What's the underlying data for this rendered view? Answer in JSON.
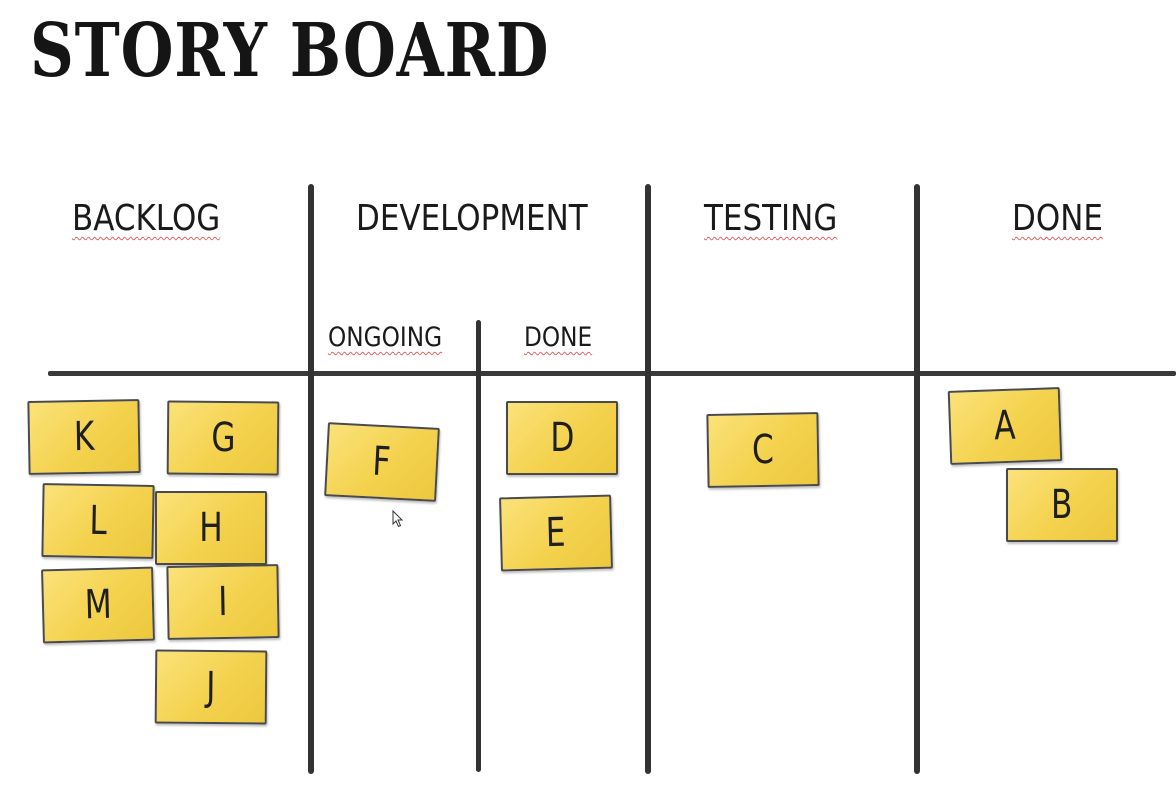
{
  "title": "STORY BOARD",
  "columns": {
    "backlog": "BACKLOG",
    "development": "DEVELOPMENT",
    "testing": "TESTING",
    "done": "DONE"
  },
  "development_subcolumns": {
    "ongoing": "ONGOING",
    "done": "DONE"
  },
  "cards": {
    "backlog": [
      "K",
      "G",
      "L",
      "H",
      "M",
      "I",
      "J"
    ],
    "dev_ongoing": [
      "F"
    ],
    "dev_done": [
      "D",
      "E"
    ],
    "testing": [
      "C"
    ],
    "done": [
      "A",
      "B"
    ]
  },
  "colors": {
    "sticky_note": "#f4d24e",
    "lines": "#333333",
    "background": "#ffffff"
  }
}
